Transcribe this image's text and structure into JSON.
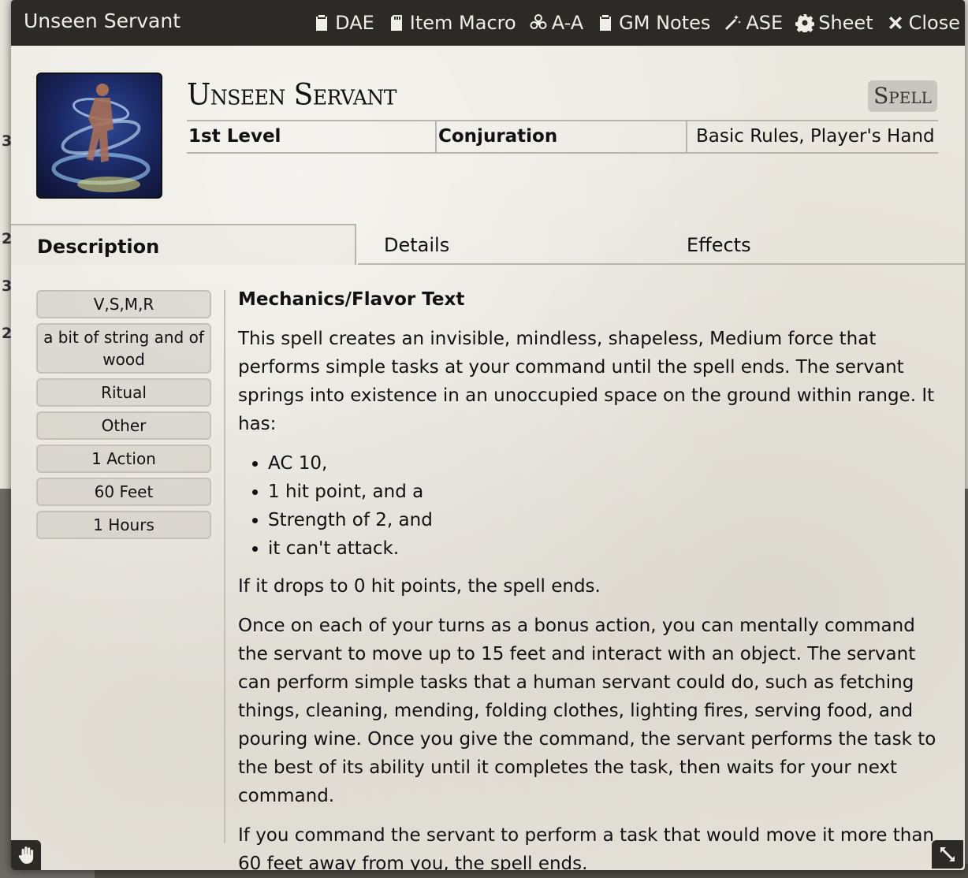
{
  "background": {
    "row_numbers": [
      "3",
      "2",
      "3",
      "2"
    ]
  },
  "window": {
    "title": "Unseen Servant",
    "header_buttons": [
      {
        "label": "DAE",
        "icon": "clipboard-icon"
      },
      {
        "label": "Item Macro",
        "icon": "sd-card-icon"
      },
      {
        "label": "A-A",
        "icon": "biohazard-icon"
      },
      {
        "label": "GM Notes",
        "icon": "clipboard-icon"
      },
      {
        "label": "ASE",
        "icon": "magic-wand-icon"
      },
      {
        "label": "Sheet",
        "icon": "gear-icon"
      },
      {
        "label": "Close",
        "icon": "close-icon"
      }
    ]
  },
  "item": {
    "name": "Unseen Servant",
    "type": "Spell",
    "level": "1st Level",
    "school": "Conjuration",
    "source": "Basic Rules, Player's Hand"
  },
  "tabs": [
    "Description",
    "Details",
    "Effects"
  ],
  "properties": [
    "V,S,M,R",
    "a bit of string and of wood",
    "Ritual",
    "Other",
    "1 Action",
    "60 Feet",
    "1 Hours"
  ],
  "description": {
    "heading": "Mechanics/Flavor Text",
    "intro": "This spell creates an invisible, mindless, shapeless, Medium force that performs simple tasks at your command until the spell ends. The servant springs into existence in an unoccupied space on the ground within range. It has:",
    "bullets": [
      "AC 10,",
      "1 hit point, and a",
      "Strength of 2, and",
      "it can't attack."
    ],
    "p2": "If it drops to 0 hit points, the spell ends.",
    "p3": "Once on each of your turns as a bonus action, you can mentally command the servant to move up to 15 feet and interact with an object. The servant can perform simple tasks that a human servant could do, such as fetching things, cleaning, mending, folding clothes, lighting fires, serving food, and pouring wine. Once you give the command, the servant performs the task to the best of its ability until it completes the task, then waits for your next command.",
    "p4": "If you command the servant to perform a task that would move it more than 60 feet away from you, the spell ends."
  }
}
